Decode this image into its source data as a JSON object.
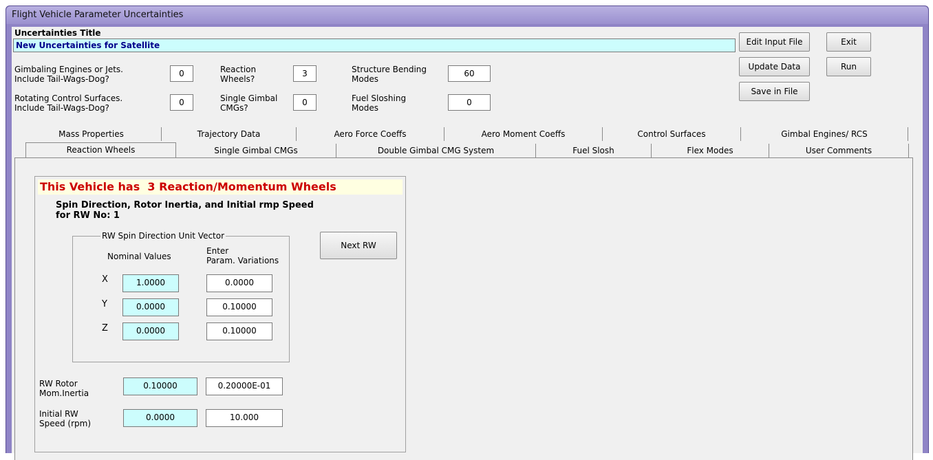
{
  "window": {
    "title": "Flight Vehicle Parameter Uncertainties"
  },
  "title_section": {
    "label": "Uncertainties Title",
    "value": "New Uncertainties for Satellite"
  },
  "buttons": {
    "edit_input_file": "Edit Input File",
    "exit": "Exit",
    "update_data": "Update Data",
    "run": "Run",
    "save_in_file": "Save in File",
    "next_rw": "Next RW"
  },
  "counts": {
    "gimbaling_engines_label": "Gimbaling Engines or Jets.\nInclude Tail-Wags-Dog?",
    "gimbaling_engines_value": "0",
    "rotating_surfaces_label": "Rotating Control Surfaces.\nInclude Tail-Wags-Dog?",
    "rotating_surfaces_value": "0",
    "reaction_wheels_label": "Reaction\nWheels?",
    "reaction_wheels_value": "3",
    "single_gimbal_label": "Single Gimbal\nCMGs?",
    "single_gimbal_value": "0",
    "structure_bending_label": "Structure Bending\nModes",
    "structure_bending_value": "60",
    "fuel_sloshing_label": "Fuel Sloshing\nModes",
    "fuel_sloshing_value": "0"
  },
  "tabs_row1": [
    "Mass Properties",
    "Trajectory Data",
    "Aero Force Coeffs",
    "Aero Moment Coeffs",
    "Control Surfaces",
    "Gimbal Engines/ RCS"
  ],
  "tabs_row2": [
    "Reaction Wheels",
    "Single Gimbal CMGs",
    "Double Gimbal CMG System",
    "Fuel Slosh",
    "Flex Modes",
    "User Comments"
  ],
  "active_tab": "Reaction Wheels",
  "panel": {
    "header": "This Vehicle has  3 Reaction/Momentum Wheels",
    "subtitle": "Spin Direction, Rotor Inertia, and Initial rmp Speed\nfor RW No:  1",
    "group_title": "RW Spin Direction Unit Vector",
    "nominal_label": "Nominal Values",
    "variation_label": "Enter\nParam. Variations",
    "rows": [
      {
        "axis": "X",
        "nominal": "1.0000",
        "variation": "0.0000"
      },
      {
        "axis": "Y",
        "nominal": "0.0000",
        "variation": "0.10000"
      },
      {
        "axis": "Z",
        "nominal": "0.0000",
        "variation": "0.10000"
      }
    ],
    "inertia_label": "RW Rotor\nMom.Inertia",
    "inertia_nominal": "0.10000",
    "inertia_variation": "0.20000E-01",
    "speed_label": "Initial RW\nSpeed (rpm)",
    "speed_nominal": "0.0000",
    "speed_variation": "10.000"
  },
  "colors": {
    "title_bar": "#9a90cf",
    "header_text": "#cc0000",
    "header_bg": "#ffffe1",
    "nominal_bg": "#ccfdfd",
    "title_value_text": "#00008b"
  }
}
